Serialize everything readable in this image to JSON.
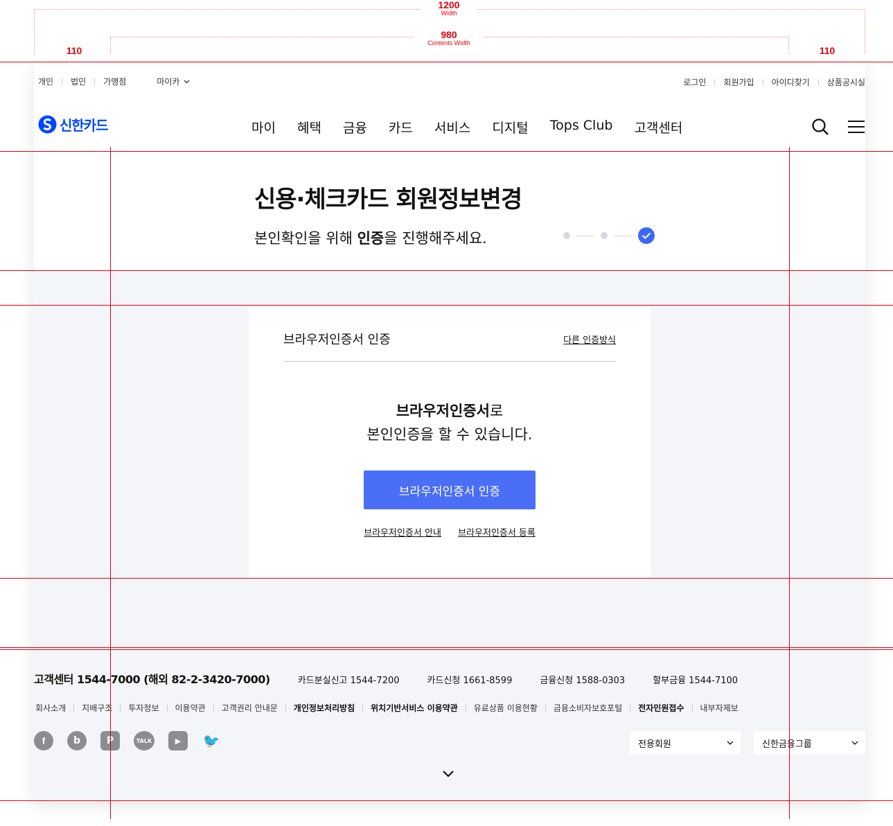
{
  "guide": {
    "width_value": "1200",
    "width_caption": "Width",
    "contents_value": "980",
    "contents_caption": "Contents Width",
    "margin_left": "110",
    "margin_right": "110"
  },
  "util": {
    "left": [
      "개인",
      "법인",
      "가맹점"
    ],
    "mycar": "마이카",
    "right": [
      "로그인",
      "회원가입",
      "아이디찾기",
      "상품공시실"
    ]
  },
  "logo": {
    "text": "신한카드"
  },
  "menu": [
    "마이",
    "혜택",
    "금융",
    "카드",
    "서비스",
    "디지털",
    "Tops Club",
    "고객센터"
  ],
  "page": {
    "title": "신용·체크카드 회원정보변경",
    "subtitle_pre": "본인확인을 위해 ",
    "subtitle_bold": "인증",
    "subtitle_post": "을 진행해주세요."
  },
  "card": {
    "title": "브라우저인증서 인증",
    "alt_link": "다른 인증방식",
    "msg_bold": "브라우저인증서",
    "msg_rest1": "로",
    "msg_line2": "본인인증을 할 수 있습니다.",
    "button": "브라우저인증서 인증",
    "links": [
      "브라우저인증서 안내",
      "브라우저인증서 등록"
    ]
  },
  "footer": {
    "main_contact": "고객센터 1544-7000 (해외 82-2-3420-7000)",
    "contacts": [
      "카드분실신고 1544-7200",
      "카드신청 1661-8599",
      "금융신청 1588-0303",
      "할부금융 1544-7100"
    ],
    "links": [
      {
        "label": "회사소개",
        "bold": false
      },
      {
        "label": "지배구조",
        "bold": false
      },
      {
        "label": "투자정보",
        "bold": false
      },
      {
        "label": "이용약관",
        "bold": false
      },
      {
        "label": "고객권리 안내문",
        "bold": false
      },
      {
        "label": "개인정보처리방침",
        "bold": true
      },
      {
        "label": "위치기반서비스 이용약관",
        "bold": true
      },
      {
        "label": "유료상품 이용현황",
        "bold": false
      },
      {
        "label": "금융소비자보호포털",
        "bold": false
      },
      {
        "label": "전자민원접수",
        "bold": true
      },
      {
        "label": "내부자제보",
        "bold": false
      }
    ],
    "sns": [
      {
        "icon": "facebook-icon",
        "glyph": "f"
      },
      {
        "icon": "blog-icon",
        "glyph": "b"
      },
      {
        "icon": "post-icon",
        "glyph": "P"
      },
      {
        "icon": "kakao-talk-icon",
        "glyph": "TALK"
      },
      {
        "icon": "youtube-icon",
        "glyph": "▶"
      },
      {
        "icon": "twitter-icon",
        "glyph": "🐦"
      }
    ],
    "select1": "전용회원",
    "select2": "신한금융그룹"
  },
  "colors": {
    "accent": "#4a6ef5",
    "brand": "#0046ff",
    "guide": "#e60012",
    "bg": "#f3f5f9"
  }
}
